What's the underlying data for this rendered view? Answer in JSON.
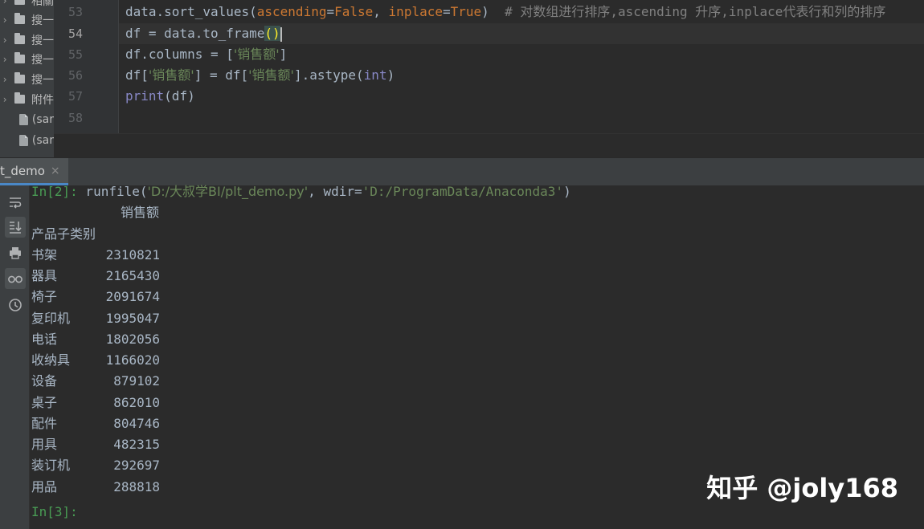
{
  "project_tree": {
    "items": [
      {
        "type": "folder",
        "label": "相關"
      },
      {
        "type": "folder",
        "label": "搜一"
      },
      {
        "type": "folder",
        "label": "搜一"
      },
      {
        "type": "folder",
        "label": "搜一"
      },
      {
        "type": "folder",
        "label": "搜一"
      },
      {
        "type": "folder",
        "label": "附件"
      },
      {
        "type": "file",
        "label": "(sar"
      },
      {
        "type": "file",
        "label": "(sar"
      }
    ]
  },
  "editor": {
    "lines": [
      {
        "number": "53",
        "current": false
      },
      {
        "number": "54",
        "current": true
      },
      {
        "number": "55",
        "current": false
      },
      {
        "number": "56",
        "current": false
      },
      {
        "number": "57",
        "current": false
      },
      {
        "number": "58",
        "current": false
      }
    ],
    "code": {
      "l53_a": "data.sort_values(",
      "l53_b": "ascending",
      "l53_c": "=",
      "l53_d": "False",
      "l53_e": ", ",
      "l53_f": "inplace",
      "l53_g": "=",
      "l53_h": "True",
      "l53_i": ")  ",
      "l53_comment": "# 对数组进行排序,ascending 升序,inplace代表行和列的排序",
      "l54_a": "df = data.to_frame",
      "l54_paren": "()",
      "l55_a": "df.columns = [",
      "l55_str": "'销售额'",
      "l55_b": "]",
      "l56_a": "df[",
      "l56_str1": "'销售额'",
      "l56_b": "] = df[",
      "l56_str2": "'销售额'",
      "l56_c": "].astype(",
      "l56_int": "int",
      "l56_d": ")",
      "l57_print": "print",
      "l57_a": "(df)"
    }
  },
  "console_tab": {
    "label": "t_demo",
    "close": "×"
  },
  "console": {
    "in2_prompt": "In[2]:",
    "run_a": " runfile(",
    "run_str1": "'D:/大叔学BI/plt_demo.py'",
    "run_b": ", wdir=",
    "run_str2": "'D:/ProgramData/Anaconda3'",
    "run_c": ")",
    "column_header": "销售额",
    "index_name": "产品子类别",
    "rows": [
      {
        "label": "书架",
        "value": "2310821"
      },
      {
        "label": "器具",
        "value": "2165430"
      },
      {
        "label": "椅子",
        "value": "2091674"
      },
      {
        "label": "复印机",
        "value": "1995047"
      },
      {
        "label": "电话",
        "value": "1802056"
      },
      {
        "label": "收纳具",
        "value": "1166020"
      },
      {
        "label": "设备",
        "value": "879102"
      },
      {
        "label": "桌子",
        "value": "862010"
      },
      {
        "label": "配件",
        "value": "804746"
      },
      {
        "label": "用具",
        "value": "482315"
      },
      {
        "label": "装订机",
        "value": "292697"
      },
      {
        "label": "用品",
        "value": "288818"
      }
    ],
    "in3_prompt": "In[3]:"
  },
  "watermark": "知乎 @joly168"
}
